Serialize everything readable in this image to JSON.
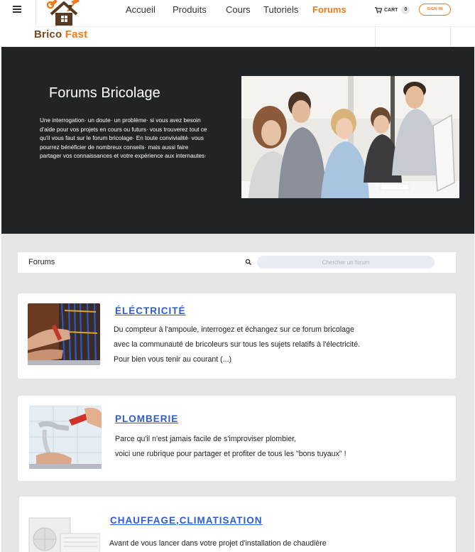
{
  "brand": {
    "name_part1": "Brico",
    "name_part2": "Fast",
    "icon": "house-tools-logo-icon"
  },
  "nav": {
    "items": [
      {
        "label": "Accueil",
        "active": false
      },
      {
        "label": "Produits",
        "active": false
      },
      {
        "label": "Cours",
        "active": false
      },
      {
        "label": "Tutoriels",
        "active": false
      },
      {
        "label": "Forums",
        "active": true
      }
    ],
    "cart_label": "CART",
    "cart_count": "0",
    "signin_label": "SIGN IN"
  },
  "hero": {
    "title": "Forums Bricolage",
    "text_lines": [
      "Une interrogation· un doute· un problème· si vous avez besoin",
      "d'aide pour vos projets en cours ou futurs· vous trouverez tout ce",
      "qu'il vous faut sur le forum bricolage· En toute convivialité· vous",
      "pourrez bénéficier de nombreux conseils· mais aussi faire",
      "partager vos connaissances et votre expérience aux internautes·"
    ]
  },
  "forums": {
    "label": "Forums",
    "search_placeholder": "Chercher un forum",
    "categories": [
      {
        "title": "ÉLÉCTRICITÉ",
        "lines": [
          "Du compteur à l'ampoule, interrogez et échangez sur ce forum bricolage",
          "avec la communauté de bricoleurs  sur tous les sujets relatifs à l'électricité.",
          " Pour bien vous tenir au courant (...)"
        ]
      },
      {
        "title": "PLOMBERIE",
        "lines": [
          "Parce qu'il n'est jamais facile de s'improviser plombier,",
          "voici une rubrique pour partager et profiter  de tous les \"bons tuyaux\" !"
        ]
      },
      {
        "title": "CHAUFFAGE,CLIMATISATION",
        "lines": [
          "Avant de vous lancer dans votre projet d'installation de chaudière"
        ]
      }
    ]
  },
  "colors": {
    "accent": "#f07b1c",
    "brand_brown": "#7a4a1e",
    "hero_bg": "#222326",
    "link_blue": "#2d5bd8",
    "content_bg": "#e6e6e6"
  }
}
